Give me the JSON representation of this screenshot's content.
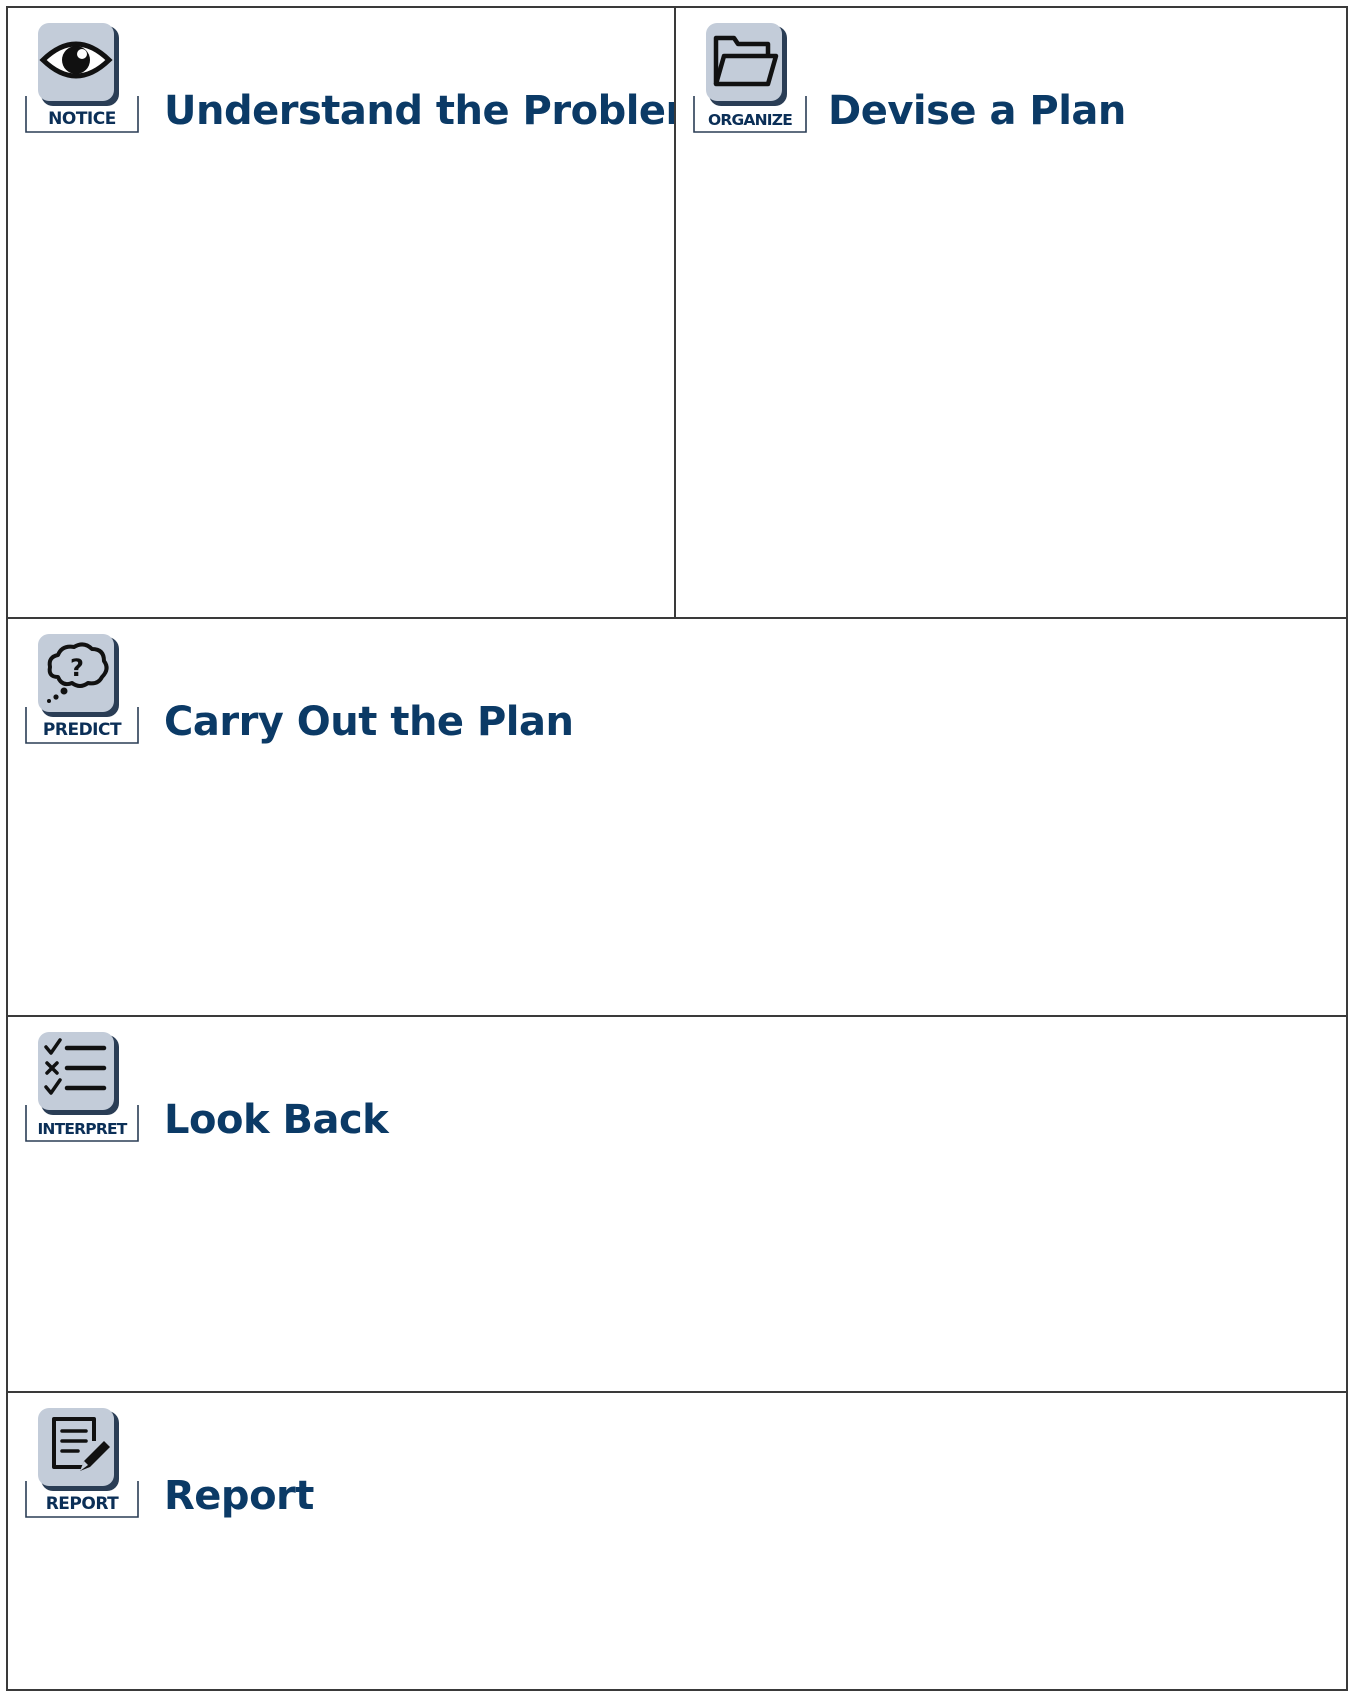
{
  "sections": [
    {
      "id": "understand",
      "badge": "NOTICE",
      "icon": "eye-icon",
      "title": "Understand the Problem"
    },
    {
      "id": "devise",
      "badge": "ORGANIZE",
      "icon": "folder-icon",
      "title": "Devise a Plan"
    },
    {
      "id": "carry",
      "badge": "PREDICT",
      "icon": "thought-bubble-question-icon",
      "title": "Carry Out the Plan"
    },
    {
      "id": "look",
      "badge": "INTERPRET",
      "icon": "checklist-icon",
      "title": "Look Back"
    },
    {
      "id": "report",
      "badge": "REPORT",
      "icon": "document-pencil-icon",
      "title": "Report"
    }
  ],
  "colors": {
    "heading": "#0b3a66",
    "badge_text": "#0b2f57",
    "icon_tile": "#c3ccd9",
    "border": "#3a3a3a"
  }
}
